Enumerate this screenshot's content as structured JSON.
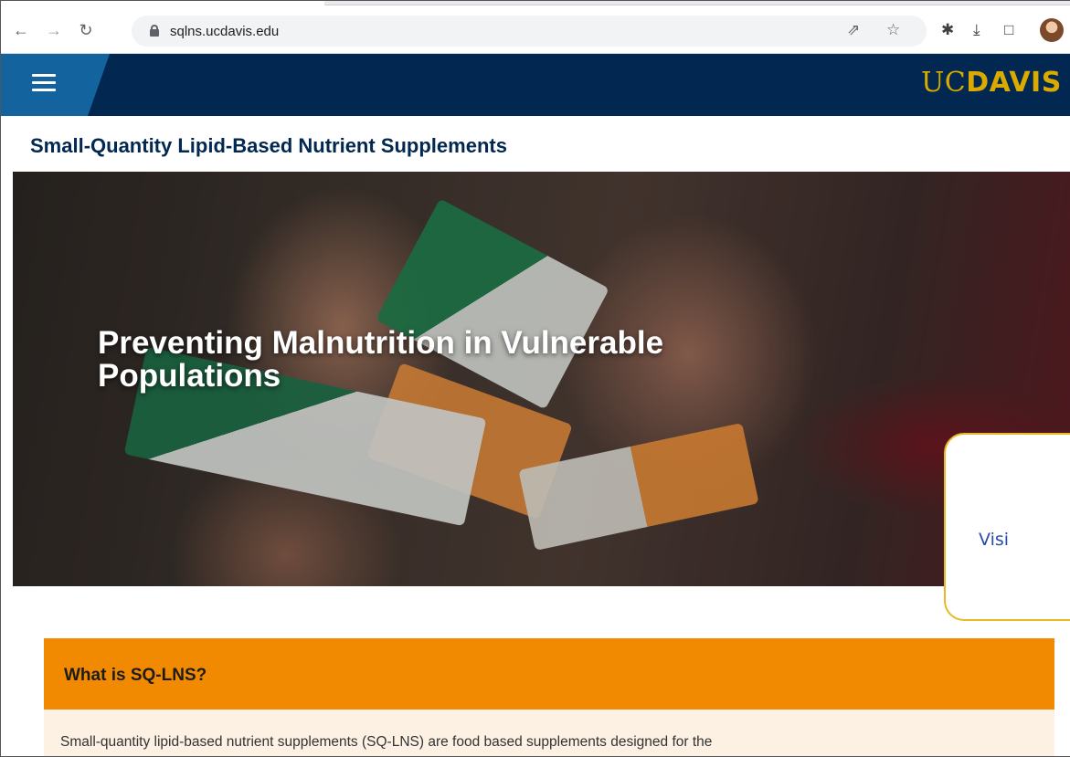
{
  "browser": {
    "url": "sqlns.ucdavis.edu",
    "icons": [
      "back-icon",
      "forward-icon",
      "reload-icon",
      "lock-icon",
      "share-icon",
      "bookmark-star-icon",
      "extensions-icon",
      "download-icon",
      "sidepanel-icon",
      "profile-avatar"
    ]
  },
  "header": {
    "logo_uc": "UC",
    "logo_davis": "DAVIS",
    "colors": {
      "navy": "#022851",
      "blue": "#13639e",
      "gold": "#daaa00"
    }
  },
  "site": {
    "title": "Small-Quantity Lipid-Based Nutrient Supplements"
  },
  "hero": {
    "title": "Preventing Malnutrition in Vulnerable Populations"
  },
  "callout": {
    "text": "Visi",
    "border_color": "#e8b82b"
  },
  "info": {
    "heading": "What is SQ-LNS?",
    "body": "Small-quantity lipid-based nutrient supplements (SQ-LNS) are food based supplements designed for the",
    "accent": "#f18a00"
  }
}
